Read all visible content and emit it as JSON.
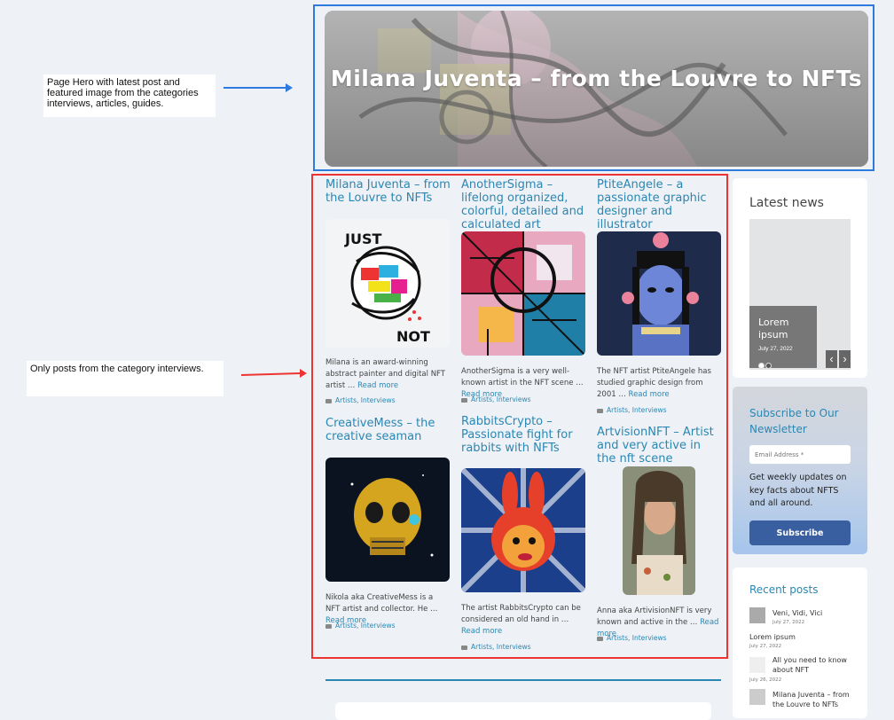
{
  "annotations": {
    "hero_note": "Page Hero with latest post and featured image  from the categories interviews, articles, guides.",
    "posts_note": "Only posts from the category interviews."
  },
  "hero": {
    "title": "Milana Juventa – from the Louvre to NFTs"
  },
  "posts": [
    {
      "title": "Milana Juventa – from the Louvre to NFTs",
      "excerpt": "Milana is an award-winning abstract painter and digital NFT artist …",
      "read_more": "Read more",
      "categories": "Artists, Interviews",
      "image_text_top": "JUST",
      "image_text_bottom": "NOT"
    },
    {
      "title": "AnotherSigma – lifelong organized, colorful, detailed and calculated art",
      "excerpt": "AnotherSigma is a very well-known artist in the NFT scene …",
      "read_more": "Read more",
      "categories": "Artists, Interviews"
    },
    {
      "title": "PtiteAngele – a passionate graphic designer and illustrator",
      "excerpt": "The NFT artist PtiteAngele has studied graphic design from 2001 …",
      "read_more": "Read more",
      "categories": "Artists, Interviews"
    },
    {
      "title": "CreativeMess – the creative seaman",
      "excerpt": "Nikola aka CreativeMess is a NFT artist and collector. He …",
      "read_more": "Read more",
      "categories": "Artists, Interviews"
    },
    {
      "title": "RabbitsCrypto – Passionate fight for rabbits with NFTs",
      "excerpt": "The artist RabbitsCrypto can be considered an old hand in …",
      "read_more": "Read more",
      "categories": "Artists, Interviews"
    },
    {
      "title": "ArtvisionNFT – Artist and very active in the nft scene",
      "excerpt": "Anna aka ArtivisionNFT is very known and active in the …",
      "read_more": "Read more",
      "categories": "Artists, Interviews"
    }
  ],
  "sidebar": {
    "latest_news": {
      "title": "Latest news",
      "slide_title": "Lorem ipsum",
      "slide_date": "July 27, 2022",
      "prev_icon": "‹",
      "next_icon": "›"
    },
    "newsletter": {
      "title": "Subscribe to Our Newsletter",
      "email_placeholder": "Email Address *",
      "text": "Get weekly updates on key facts about NFTS and all around.",
      "button": "Subscribe"
    },
    "recent_posts": {
      "title": "Recent posts",
      "items": [
        {
          "title": "Veni, Vidi, Vici",
          "date": "July 27, 2022"
        },
        {
          "title": "Lorem ipsum",
          "date": "July 27, 2022"
        },
        {
          "title": "All you need to know about NFT",
          "date": "July 26, 2022"
        },
        {
          "title": "Milana Juventa – from the Louvre to NFTs",
          "date": ""
        }
      ]
    }
  },
  "colors": {
    "accent": "#2a87b3",
    "hero_frame": "#2e7be0",
    "posts_frame": "#ee3333",
    "button": "#3a5fa0"
  }
}
